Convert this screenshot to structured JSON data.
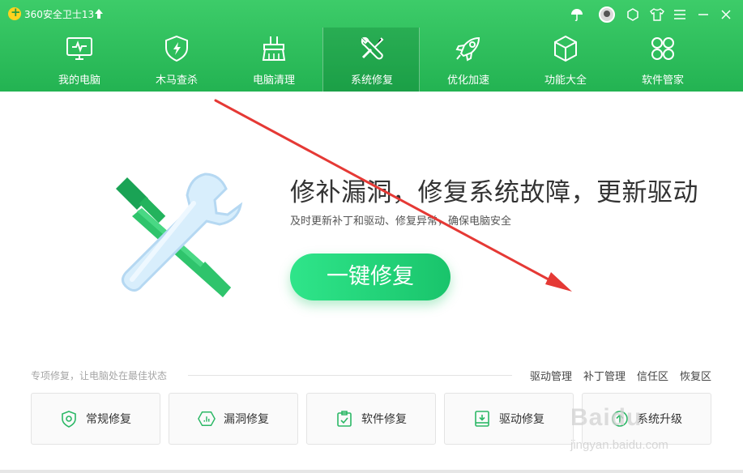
{
  "app": {
    "title": "360安全卫士13"
  },
  "titlebar": {
    "icons": [
      "upgrade-arrow-icon",
      "umbrella-icon",
      "avatar",
      "skin-icon",
      "shirt-icon",
      "menu-icon",
      "minimize-icon",
      "close-icon"
    ]
  },
  "nav": {
    "items": [
      {
        "label": "我的电脑",
        "icon": "monitor-icon"
      },
      {
        "label": "木马查杀",
        "icon": "shield-bolt-icon"
      },
      {
        "label": "电脑清理",
        "icon": "broom-icon"
      },
      {
        "label": "系统修复",
        "icon": "wrench-screwdriver-icon",
        "active": true
      },
      {
        "label": "优化加速",
        "icon": "rocket-icon"
      },
      {
        "label": "功能大全",
        "icon": "cube-icon"
      },
      {
        "label": "软件管家",
        "icon": "apps-grid-icon"
      }
    ]
  },
  "hero": {
    "title": "修补漏洞，修复系统故障，更新驱动",
    "subtitle": "及时更新补丁和驱动、修复异常，确保电脑安全",
    "button_label": "一键修复"
  },
  "section": {
    "caption": "专项修复，让电脑处在最佳状态",
    "links": [
      "驱动管理",
      "补丁管理",
      "信任区",
      "恢复区"
    ]
  },
  "cards": [
    {
      "label": "常规修复",
      "icon": "shield-icon"
    },
    {
      "label": "漏洞修复",
      "icon": "hexagon-chart-icon"
    },
    {
      "label": "软件修复",
      "icon": "clipboard-check-icon"
    },
    {
      "label": "驱动修复",
      "icon": "book-download-icon"
    },
    {
      "label": "系统升级",
      "icon": "upgrade-circle-icon"
    }
  ],
  "watermark": {
    "brand": "Baidu",
    "sub": "jingyan.baidu.com"
  },
  "colors": {
    "header": "#2dbe5a",
    "accent": "#1fc46b",
    "annotation_arrow": "#e53935"
  }
}
